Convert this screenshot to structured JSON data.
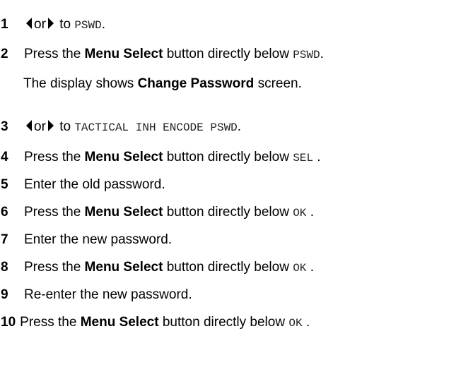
{
  "steps": [
    {
      "num": "1",
      "or": "or",
      "to": "to",
      "code": "PSWD",
      "end": "."
    },
    {
      "num": "2",
      "pre": "Press the",
      "bold": "Menu Select",
      "post": "button directly below",
      "code": "PSWD",
      "end": "."
    },
    {
      "note_pre": "The display shows",
      "note_bold": "Change Password",
      "note_post": "screen."
    },
    {
      "num": "3",
      "or": "or",
      "to": "to",
      "code": "TACTICAL INH ENCODE PSWD",
      "end": "."
    },
    {
      "num": "4",
      "pre": "Press the",
      "bold": "Menu Select",
      "post": "button directly below",
      "code": "SEL",
      "end": "."
    },
    {
      "num": "5",
      "text": "Enter the old password."
    },
    {
      "num": "6",
      "pre": "Press the",
      "bold": "Menu Select",
      "post": "button directly below",
      "code": "OK",
      "end": "."
    },
    {
      "num": "7",
      "text": "Enter the new password."
    },
    {
      "num": "8",
      "pre": "Press the",
      "bold": "Menu Select",
      "post": "button directly below",
      "code": "OK",
      "end": "."
    },
    {
      "num": "9",
      "text": "Re-enter the new password."
    },
    {
      "num": "10",
      "pre": "Press the",
      "bold": "Menu Select",
      "post": "button directly below",
      "code": "OK",
      "end": "."
    }
  ],
  "icons": {
    "left": "left-arrow-icon",
    "right": "right-arrow-icon"
  }
}
